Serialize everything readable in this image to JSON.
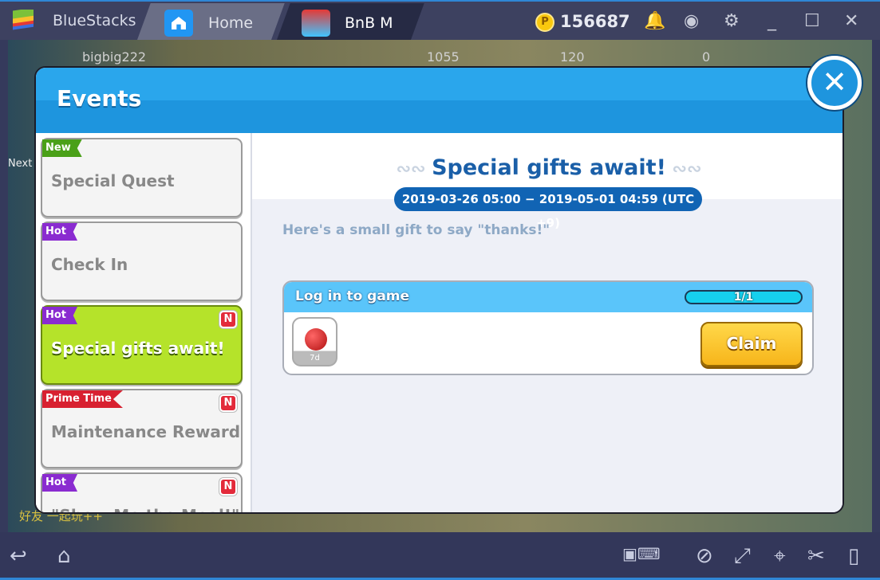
{
  "titlebar": {
    "app": "BlueStacks",
    "tabs": [
      {
        "label": "Home"
      },
      {
        "label": "BnB M"
      }
    ],
    "coins": "156687",
    "coin_symbol": "P",
    "icons": [
      "bell-icon",
      "account-icon",
      "gear-icon",
      "minimize-icon",
      "maximize-icon",
      "close-icon"
    ]
  },
  "game_hud": {
    "player": "bigbig222",
    "gold": "1055",
    "gems": "120",
    "crystals": "0",
    "chat": "好友 一起玩++",
    "left_label": "Next"
  },
  "dialog": {
    "title": "Events",
    "close": "✕",
    "events": [
      {
        "badge": "New",
        "label": "Special Quest",
        "new": false
      },
      {
        "badge": "Hot",
        "label": "Check In",
        "new": false
      },
      {
        "badge": "Hot",
        "label": "Special gifts await!",
        "new": true,
        "active": true
      },
      {
        "badge": "Prime Time",
        "label": "Maintenance Reward",
        "new": true
      },
      {
        "badge": "Hot",
        "label": "\"Show Me the Meal!\"",
        "new": true
      }
    ],
    "n_badge": "N",
    "detail": {
      "title": "Special gifts await!",
      "period": "2019-03-26 05:00 − 2019-05-01 04:59 (UTC +9)",
      "subtitle": "Here's a small gift to say \"thanks!\"",
      "task": {
        "title": "Log in to game",
        "progress": "1/1",
        "progress_fraction": 1.0,
        "reward_tag": "7d",
        "claim": "Claim"
      }
    }
  },
  "colors": {
    "header": "#1e95de",
    "active_item": "#b5e32a",
    "claim": "#f7b51a",
    "date_pill": "#1164b4"
  }
}
